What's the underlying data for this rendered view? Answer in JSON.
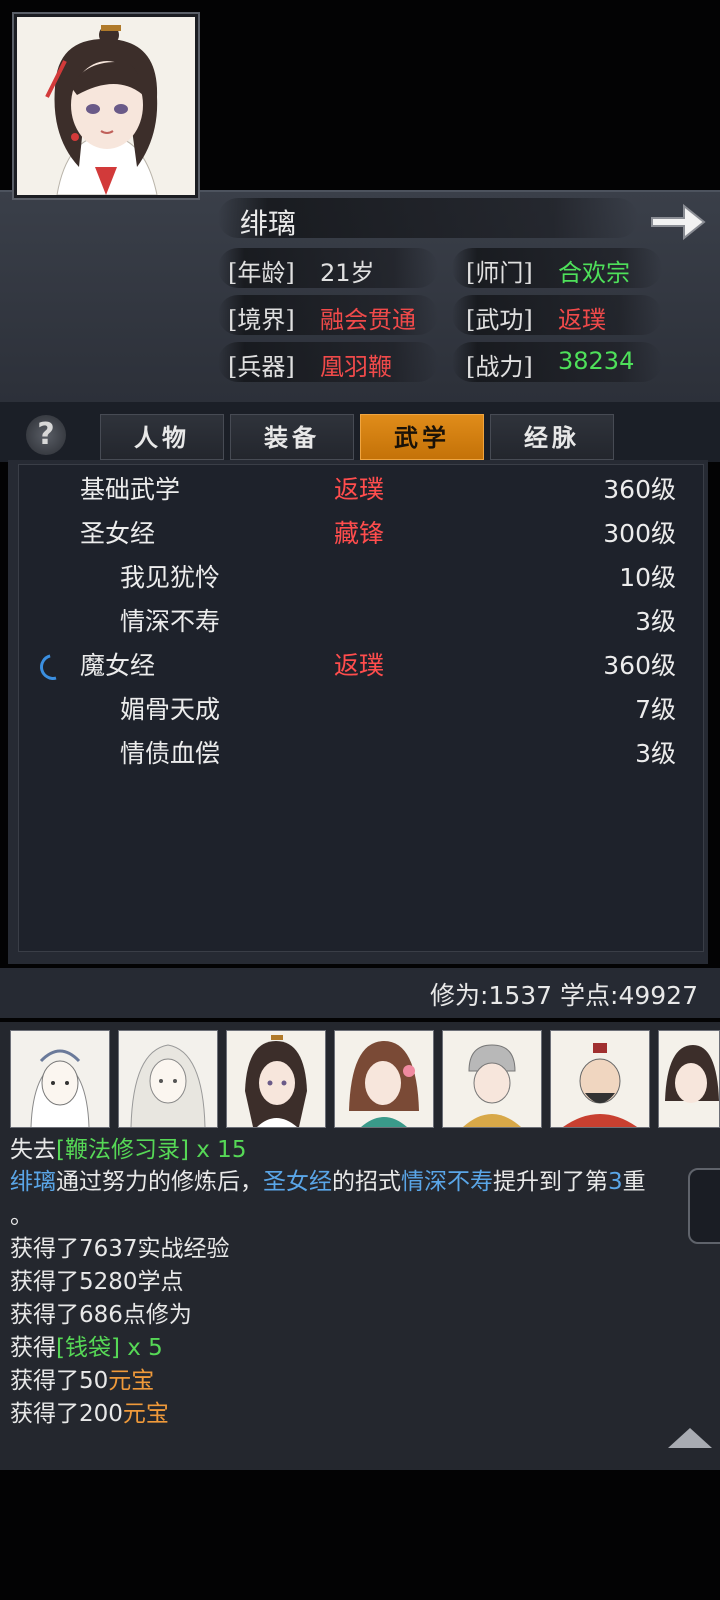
{
  "header": {
    "name": "绯璃",
    "fields": [
      {
        "label": "[年龄]",
        "value": "21岁",
        "color": "#e0e0e0"
      },
      {
        "label": "[师门]",
        "value": "合欢宗",
        "color": "#4ee05a"
      },
      {
        "label": "[境界]",
        "value": "融会贯通",
        "color": "#f04a4a"
      },
      {
        "label": "[武功]",
        "value": "返璞",
        "color": "#f04a4a"
      },
      {
        "label": "[兵器]",
        "value": "凰羽鞭",
        "color": "#f04a4a"
      },
      {
        "label": "[战力]",
        "value": "38234",
        "color": "#4ee05a"
      }
    ]
  },
  "tabs": [
    {
      "label": "人物",
      "active": false
    },
    {
      "label": "装备",
      "active": false
    },
    {
      "label": "武学",
      "active": true
    },
    {
      "label": "经脉",
      "active": false
    }
  ],
  "help_glyph": "?",
  "skills": [
    {
      "name": "基础武学",
      "realm": "返璞",
      "level": "360级",
      "sub": false
    },
    {
      "name": "圣女经",
      "realm": "藏锋",
      "level": "300级",
      "sub": false
    },
    {
      "name": "我见犹怜",
      "realm": "",
      "level": "10级",
      "sub": true
    },
    {
      "name": "情深不寿",
      "realm": "",
      "level": "3级",
      "sub": true
    },
    {
      "name": "魔女经",
      "realm": "返璞",
      "level": "360级",
      "sub": false,
      "practicing": true
    },
    {
      "name": "媚骨天成",
      "realm": "",
      "level": "7级",
      "sub": true
    },
    {
      "name": "情债血偿",
      "realm": "",
      "level": "3级",
      "sub": true
    }
  ],
  "stats": "修为:1537  学点:49927",
  "log": {
    "l1": {
      "a": "失去",
      "b": "[鞭法修习录]",
      "c": " x 15"
    },
    "l2": {
      "a": "绯璃",
      "b": "通过努力的修炼后，",
      "c": "圣女经",
      "d": "的招式",
      "e": "情深不寿",
      "f": "提升到了第",
      "g": "3",
      "h": "重"
    },
    "l3": "。",
    "l4": "获得了7637实战经验",
    "l5": "获得了5280学点",
    "l6": "获得了686点修为",
    "l7": {
      "a": "获得",
      "b": "[钱袋]",
      "c": " x 5"
    },
    "l8": {
      "a": "获得了50",
      "b": "元宝"
    },
    "l9": {
      "a": "获得了200",
      "b": "元宝"
    }
  },
  "icons": {
    "next": "arrow-right-icon",
    "help": "question-icon",
    "practicing": "spinner-icon",
    "scroll_up": "triangle-up-icon"
  },
  "colors": {
    "accent_tab": "#e08c1a",
    "realm_red": "#f04a4a",
    "value_green": "#4ee05a",
    "link_blue": "#5aa6e8",
    "currency_orange": "#f09a3a"
  }
}
